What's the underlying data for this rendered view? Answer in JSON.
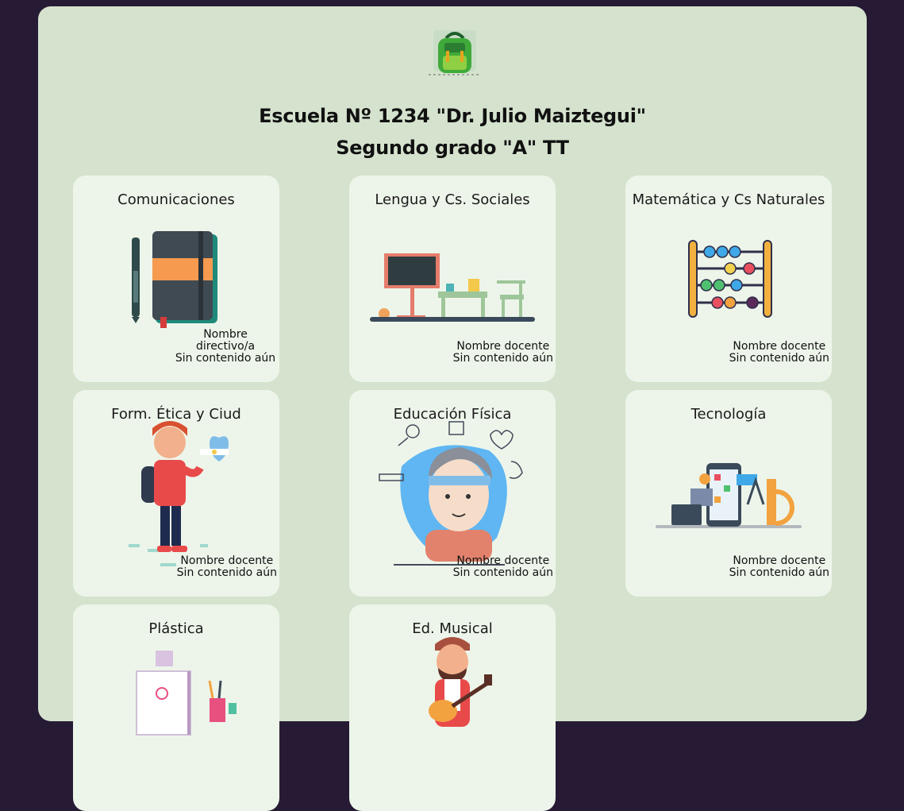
{
  "header": {
    "school_name": "Escuela Nº 1234 \"Dr. Julio Maiztegui\"",
    "grade": "Segundo grado \"A\" TT",
    "logo_icon": "backpack-icon"
  },
  "cards": [
    {
      "title": "Comunicaciones",
      "meta_role": "Nombre directivo/a",
      "meta_status": "Sin contenido aún",
      "icon": "notebook-pen-icon"
    },
    {
      "title": "Lengua y Cs. Sociales",
      "meta_role": "Nombre docente",
      "meta_status": "Sin contenido aún",
      "icon": "classroom-icon"
    },
    {
      "title": "Matemática y Cs Naturales",
      "meta_role": "Nombre docente",
      "meta_status": "Sin contenido aún",
      "icon": "abacus-icon"
    },
    {
      "title": "Form. Ética y Ciud",
      "meta_role": "Nombre docente",
      "meta_status": "Sin contenido aún",
      "icon": "student-heart-icon"
    },
    {
      "title": "Educación Física",
      "meta_role": "Nombre docente",
      "meta_status": "Sin contenido aún",
      "icon": "fitness-kid-icon"
    },
    {
      "title": "Tecnología",
      "meta_role": "Nombre docente",
      "meta_status": "Sin contenido aún",
      "icon": "technology-devices-icon"
    },
    {
      "title": "Plástica",
      "meta_role": "",
      "meta_status": "",
      "icon": "art-supplies-icon"
    },
    {
      "title": "Ed. Musical",
      "meta_role": "",
      "meta_status": "",
      "icon": "guitar-player-icon"
    }
  ]
}
